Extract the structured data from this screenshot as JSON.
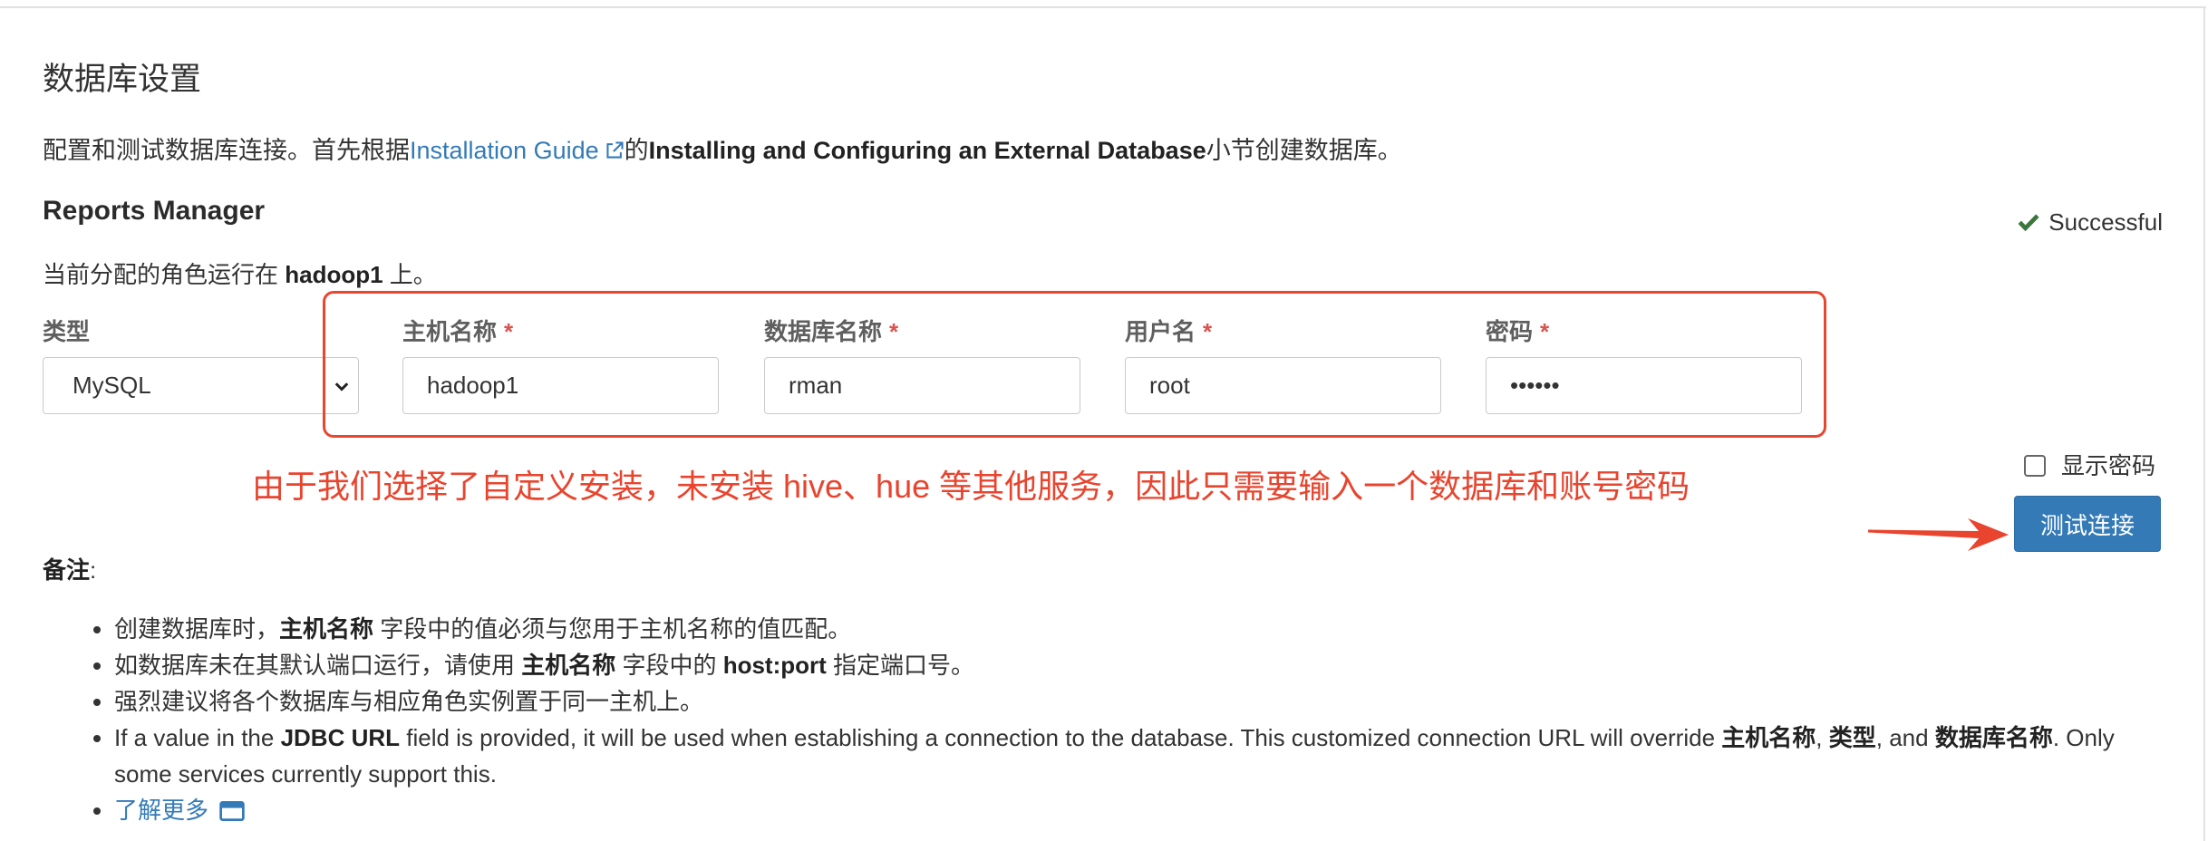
{
  "page": {
    "title": "数据库设置"
  },
  "intro": {
    "prefix": "配置和测试数据库连接。首先根据",
    "link_text": "Installation Guide",
    "link_icon": "external-link-icon",
    "middle": "的",
    "bold_section": "Installing and Configuring an External Database",
    "suffix": "小节创建数据库。"
  },
  "reports_manager": {
    "heading": "Reports Manager",
    "status": {
      "icon": "check-icon",
      "text": "Successful",
      "color": "#3c763d"
    },
    "role_line": {
      "prefix": "当前分配的角色运行在 ",
      "host": "hadoop1",
      "suffix": " 上。"
    },
    "fields": {
      "type": {
        "label": "类型",
        "value": "MySQL",
        "icon": "chevron-down-icon"
      },
      "host": {
        "label": "主机名称",
        "required_mark": "*",
        "value": "hadoop1"
      },
      "database": {
        "label": "数据库名称",
        "required_mark": "*",
        "value": "rman"
      },
      "username": {
        "label": "用户名",
        "required_mark": "*",
        "value": "root"
      },
      "password": {
        "label": "密码",
        "required_mark": "*",
        "value": "••••••"
      }
    },
    "show_password": {
      "label": "显示密码",
      "checked": false
    },
    "test_button": {
      "label": "测试连接"
    }
  },
  "overlay_annotation": {
    "text": "由于我们选择了自定义安装，未安装 hive、hue 等其他服务，因此只需要输入一个数据库和账号密码",
    "text_color": "#e8442e",
    "box_color": "#e8462f",
    "arrow_color": "#e8442e"
  },
  "notes": {
    "heading": "备注",
    "heading_suffix": ":",
    "items": [
      {
        "segments": [
          {
            "text": "创建数据库时，",
            "bold": false
          },
          {
            "text": "主机名称",
            "bold": true
          },
          {
            "text": " 字段中的值必须与您用于主机名称的值匹配。",
            "bold": false
          }
        ]
      },
      {
        "segments": [
          {
            "text": "如数据库未在其默认端口运行，请使用 ",
            "bold": false
          },
          {
            "text": "主机名称",
            "bold": true
          },
          {
            "text": " 字段中的 ",
            "bold": false
          },
          {
            "text": "host:port",
            "bold": true
          },
          {
            "text": " 指定端口号。",
            "bold": false
          }
        ]
      },
      {
        "segments": [
          {
            "text": "强烈建议将各个数据库与相应角色实例置于同一主机上。",
            "bold": false
          }
        ]
      },
      {
        "segments": [
          {
            "text": "If a value in the ",
            "bold": false
          },
          {
            "text": "JDBC URL",
            "bold": true
          },
          {
            "text": " field is provided, it will be used when establishing a connection to the database. This customized connection URL will override ",
            "bold": false
          },
          {
            "text": "主机名称",
            "bold": true
          },
          {
            "text": ", ",
            "bold": false
          },
          {
            "text": "类型",
            "bold": true
          },
          {
            "text": ", and ",
            "bold": false
          },
          {
            "text": "数据库名称",
            "bold": true
          },
          {
            "text": ". Only some services currently support this.",
            "bold": false
          }
        ]
      }
    ],
    "learn_more": {
      "label": "了解更多",
      "icon": "new-window-icon"
    }
  },
  "colors": {
    "link": "#337ab7",
    "button": "#337ab7",
    "required": "#d9534f"
  }
}
